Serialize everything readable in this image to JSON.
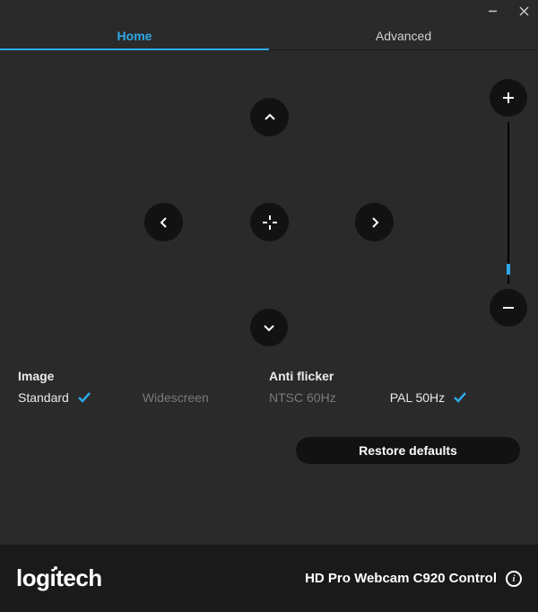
{
  "titlebar": {
    "minimize": "minimize",
    "close": "close"
  },
  "tabs": {
    "home": "Home",
    "advanced": "Advanced",
    "active": "home"
  },
  "controls": {
    "tilt_up": "Tilt up",
    "tilt_down": "Tilt down",
    "pan_left": "Pan left",
    "pan_right": "Pan right",
    "center": "Center",
    "zoom_in": "Zoom in",
    "zoom_out": "Zoom out",
    "zoom_level_percent": 6
  },
  "image": {
    "title": "Image",
    "standard": "Standard",
    "widescreen": "Widescreen",
    "selected": "standard"
  },
  "antiflicker": {
    "title": "Anti flicker",
    "ntsc": "NTSC 60Hz",
    "pal": "PAL 50Hz",
    "selected": "pal"
  },
  "restore": "Restore defaults",
  "footer": {
    "brand": "logitech",
    "product": "HD Pro Webcam C920 Control",
    "info": "i"
  }
}
